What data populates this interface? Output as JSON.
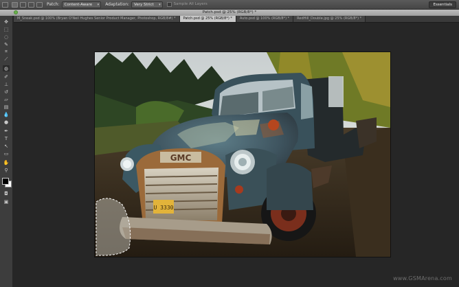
{
  "options_bar": {
    "patch_label": "Patch:",
    "patch_value": "Content-Aware",
    "adaptation_label": "Adaptation:",
    "adaptation_value": "Very Strict",
    "sample_all_layers_label": "Sample All Layers",
    "sample_all_layers_checked": false,
    "workspace_label": "Essentials"
  },
  "document": {
    "title": "Patch.psd @ 25% (RGB/8*) *"
  },
  "tabs": [
    {
      "label": "M_Sneak.psd @ 100% (Bryan O'Neil Hughes Senior Product Manager, Photoshop, RGB/8#) *",
      "active": false
    },
    {
      "label": "Patch.psd @ 25% (RGB/8*) *",
      "active": true
    },
    {
      "label": "Auto.psd @ 100% (RGB/8*) *",
      "active": false
    },
    {
      "label": "RedHill_Double.jpg @ 25% (RGB/8*) *",
      "active": false
    }
  ],
  "tools": [
    "move-tool",
    "marquee-tool",
    "lasso-tool",
    "quick-selection-tool",
    "crop-tool",
    "eyedropper-tool",
    "patch-tool",
    "brush-tool",
    "clone-stamp-tool",
    "history-brush-tool",
    "eraser-tool",
    "gradient-tool",
    "blur-tool",
    "dodge-tool",
    "pen-tool",
    "type-tool",
    "path-selection-tool",
    "rectangle-tool",
    "hand-tool",
    "zoom-tool"
  ],
  "colors": {
    "foreground": "#000000",
    "background": "#ffffff"
  },
  "watermark": "www.GSMArena.com"
}
